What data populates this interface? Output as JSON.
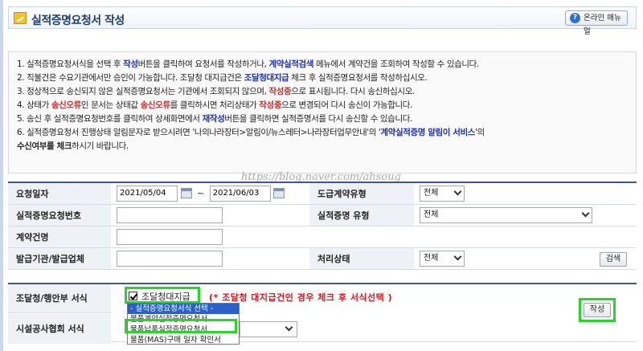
{
  "header": {
    "title": "실적증명요청서 작성",
    "manual_button": "온라인 매뉴얼"
  },
  "notices": [
    [
      [
        "1. 실적증명요청서식을 선택 후 ",
        ""
      ],
      [
        "작성",
        "b"
      ],
      [
        "버튼을 클릭하여 요청서를 작성하거나, ",
        ""
      ],
      [
        "계약실적검색",
        "b"
      ],
      [
        " 메뉴에서 계약건을 조회하여 작성할 수 있습니다.",
        ""
      ]
    ],
    [
      [
        "2. 직불건은 수요기관에서만 승인이 가능합니다. 조달청 대지급건은 ",
        ""
      ],
      [
        "조달청대지급",
        "b"
      ],
      [
        " 체크 후 실적증명요청서를 작성하십시오.",
        ""
      ]
    ],
    [
      [
        "3. 정상적으로 송신되지 않은 실적증명요청서는 기관에서 조회되지 않으며, ",
        ""
      ],
      [
        "작성중",
        "r"
      ],
      [
        "으로 표시됩니다. 다시 송신하십시오.",
        ""
      ]
    ],
    [
      [
        "4. 상태가 ",
        ""
      ],
      [
        "송신오류",
        "r"
      ],
      [
        "인 문서는 상태값 ",
        ""
      ],
      [
        "송신오류",
        "r"
      ],
      [
        "를 클릭하시면 처리상태가 ",
        ""
      ],
      [
        "작성중",
        "r"
      ],
      [
        "으로 변경되어 다시 송신이 가능합니다.",
        ""
      ]
    ],
    [
      [
        "5. 송신 후 실적증명요청번호를 클릭하여 상세화면에서 ",
        ""
      ],
      [
        "재작성",
        "b"
      ],
      [
        "버튼을 클릭하면 실적증명서를 다시 송신할 수 있습니다.",
        ""
      ]
    ],
    [
      [
        "6. 실적증명요청서 진행상태 알림문자로 받으시려면 '나의나라장터>알림이/뉴스레터>나라장터업무안내'의 '",
        ""
      ],
      [
        "계약실적증명 알림이 서비스",
        "b"
      ],
      [
        "'의",
        ""
      ]
    ],
    [
      [
        "    ",
        ""
      ],
      [
        "수신여부를 체크",
        "k"
      ],
      [
        "하시기 바랍니다.",
        ""
      ]
    ]
  ],
  "watermark": "https://blog.naver.com/ahsoug",
  "search_form": {
    "request_date_label": "요청일자",
    "date_from": "2021/05/04",
    "date_to": "2021/06/03",
    "tilde": "~",
    "contract_type_label": "도급계약유형",
    "contract_type_value": "전체",
    "request_no_label": "실적증명요청번호",
    "cert_type_label": "실적증명 유형",
    "cert_type_value": "전체",
    "contract_name_label": "계약건명",
    "issuer_label": "발급기관/발급업체",
    "status_label": "처리상태",
    "status_value": "전체",
    "search_button": "검색"
  },
  "form2": {
    "pps_label": "조달청/행안부 서식",
    "pps_checkbox_label": "조달청대지급",
    "pps_note": "(* 조달청 대지급건인 경우 체크 후 서식선택 )",
    "dropdown_options": [
      "- 실적증명요청서식 선택 -",
      "물품계약실적증명요청서",
      "물품납품실적증명요청서",
      "물품(MAS)구매 일자 확인서"
    ],
    "facility_label": "시설공사협회 서식",
    "write_button": "작성"
  },
  "colors": {
    "accent_blue": "#1a2fb8",
    "alert_red": "#d12a2a",
    "highlight_green": "#27d627"
  }
}
